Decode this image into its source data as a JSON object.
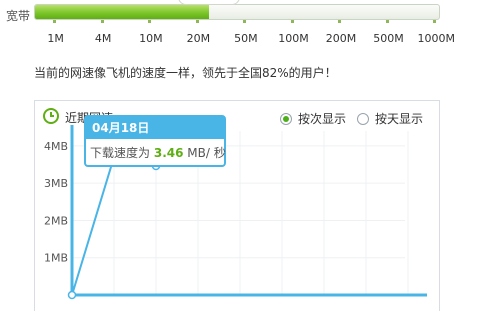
{
  "bandwidth": {
    "label": "宽带",
    "fill_percent": 43,
    "ticks": [
      "1M",
      "4M",
      "10M",
      "20M",
      "50M",
      "100M",
      "200M",
      "500M",
      "1000M"
    ]
  },
  "message": "当前的网速像飞机的速度一样，领先于全国82%的用户！",
  "panel": {
    "title": "近期网速",
    "radio_by_count": "按次显示",
    "radio_by_day": "按天显示",
    "selected": "by_count"
  },
  "chart_data": {
    "type": "line",
    "yticks": [
      "1MB",
      "2MB",
      "3MB",
      "4MB"
    ],
    "ylim": [
      0,
      4.4
    ],
    "x": [
      0,
      1,
      2
    ],
    "values": [
      0,
      3.7,
      3.46
    ],
    "grid": true
  },
  "tooltip": {
    "date": "04月18日",
    "label": "下载速度为",
    "value": "3.46",
    "unit": "MB/ 秒"
  },
  "colors": {
    "accent_green": "#5fae14",
    "accent_blue": "#49b4e6"
  }
}
